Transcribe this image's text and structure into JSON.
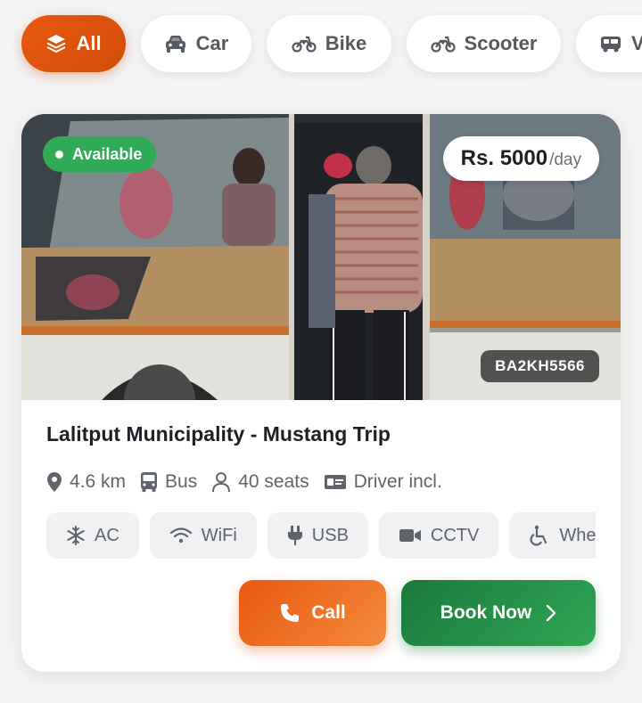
{
  "categories": [
    {
      "label": "All",
      "icon": "layers-icon",
      "active": true
    },
    {
      "label": "Car",
      "icon": "car-icon",
      "active": false
    },
    {
      "label": "Bike",
      "icon": "motorbike-icon",
      "active": false
    },
    {
      "label": "Scooter",
      "icon": "scooter-icon",
      "active": false
    },
    {
      "label": "V",
      "icon": "van-icon",
      "active": false
    }
  ],
  "listing": {
    "status": "Available",
    "price_amount": "Rs. 5000",
    "price_unit": "/day",
    "plate": "BA2KH5566",
    "title": "Lalitput Municipality - Mustang Trip",
    "meta": {
      "distance": "4.6 km",
      "type": "Bus",
      "seats": "40 seats",
      "driver": "Driver incl."
    },
    "features": [
      {
        "label": "AC",
        "icon": "snowflake-icon"
      },
      {
        "label": "WiFi",
        "icon": "wifi-icon"
      },
      {
        "label": "USB",
        "icon": "plug-icon"
      },
      {
        "label": "CCTV",
        "icon": "video-camera-icon"
      },
      {
        "label": "Whee",
        "icon": "wheelchair-icon"
      }
    ],
    "call_label": "Call",
    "book_label": "Book Now"
  },
  "colors": {
    "accent_orange": "#e8590f",
    "accent_green": "#1c7a3c",
    "available_green": "#2faa55"
  }
}
